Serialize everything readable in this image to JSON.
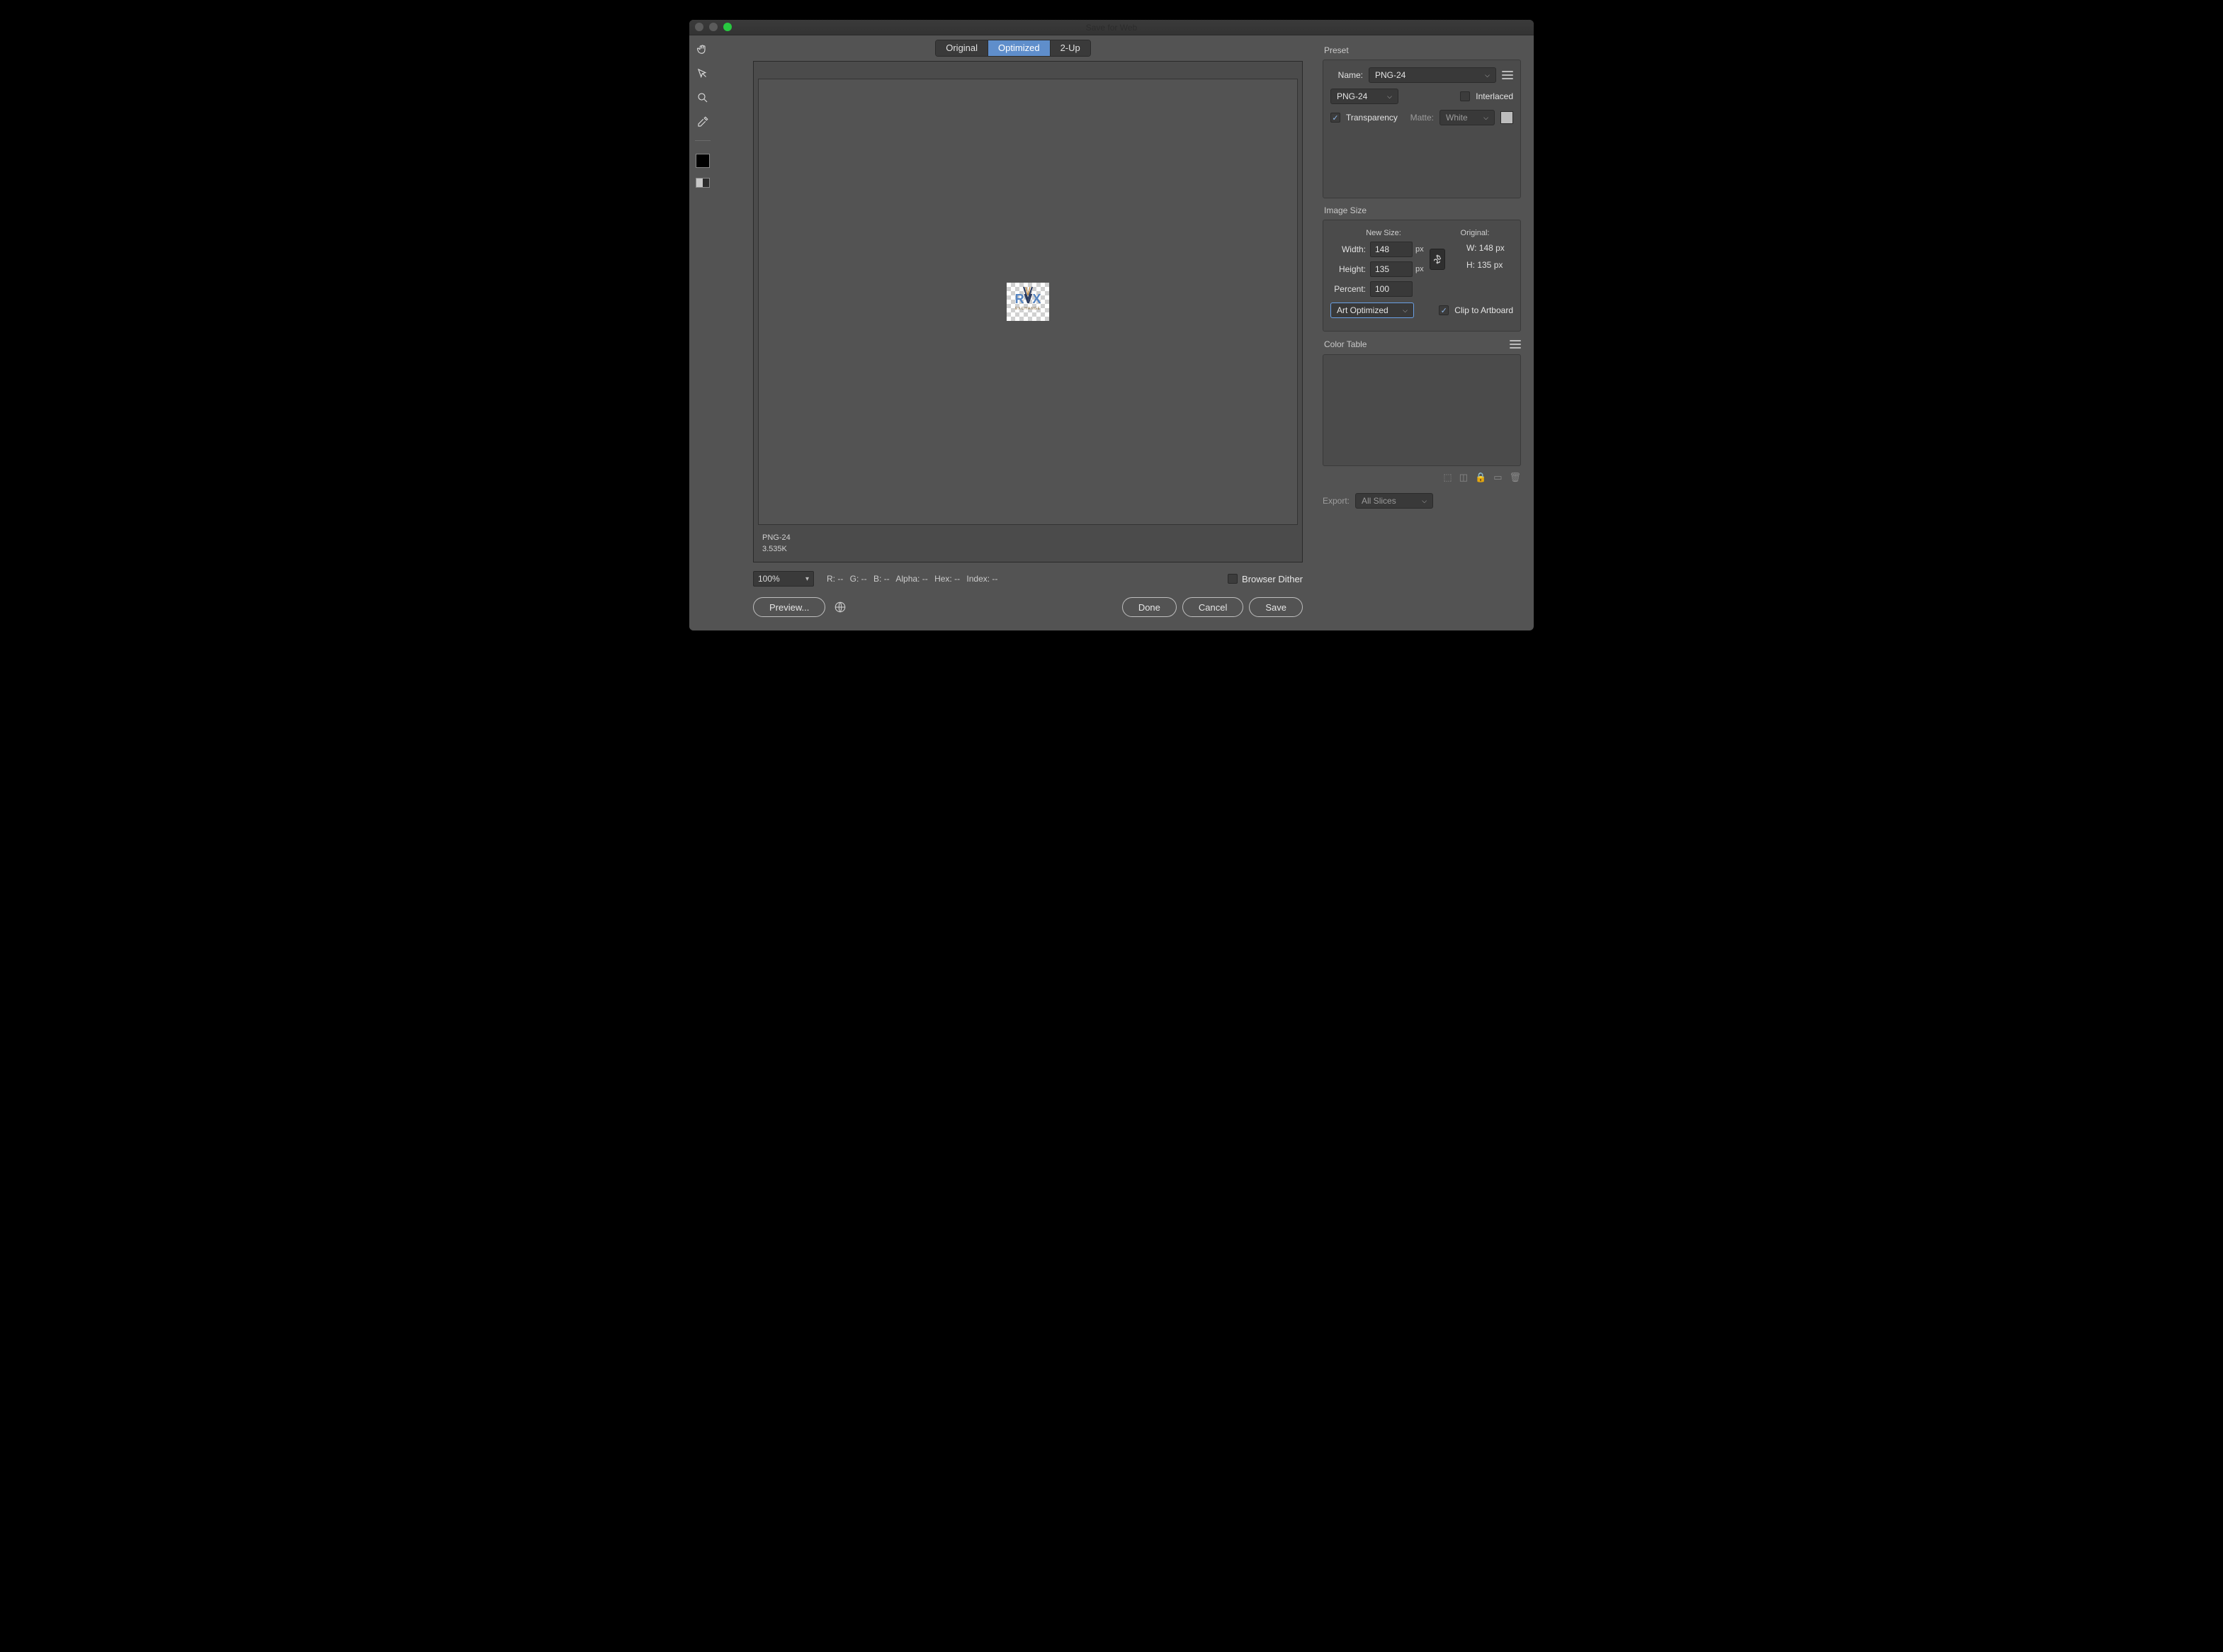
{
  "window": {
    "title": "Save for Web"
  },
  "tabs": {
    "original": "Original",
    "optimized": "Optimized",
    "two_up": "2-Up",
    "active": "optimized"
  },
  "toolbar": {
    "hand": "hand-tool",
    "slice_select": "slice-select-tool",
    "zoom": "zoom-tool",
    "eyedropper": "eyedropper-tool",
    "foreground": "foreground-color",
    "slice_vis": "toggle-slices"
  },
  "preview_meta": {
    "format": "PNG-24",
    "size": "3.535K"
  },
  "preview_logo": {
    "text_r": "R",
    "text_v": "V",
    "text_x": "X",
    "sub": "EXCHANGE"
  },
  "status": {
    "zoom": "100%",
    "r": "R: --",
    "g": "G: --",
    "b": "B: --",
    "alpha": "Alpha: --",
    "hex": "Hex: --",
    "index": "Index: --",
    "browser_dither": "Browser Dither",
    "browser_dither_checked": false
  },
  "buttons": {
    "preview": "Preview...",
    "done": "Done",
    "cancel": "Cancel",
    "save": "Save"
  },
  "preset": {
    "section": "Preset",
    "name_label": "Name:",
    "name_value": "PNG-24",
    "format_value": "PNG-24",
    "interlaced_label": "Interlaced",
    "interlaced_checked": false,
    "transparency_label": "Transparency",
    "transparency_checked": true,
    "matte_label": "Matte:",
    "matte_value": "White"
  },
  "image_size": {
    "section": "Image Size",
    "new_size_label": "New Size:",
    "original_label": "Original:",
    "width_label": "Width:",
    "width_value": "148",
    "width_unit": "px",
    "height_label": "Height:",
    "height_value": "135",
    "height_unit": "px",
    "percent_label": "Percent:",
    "percent_value": "100",
    "orig_w": "W:  148 px",
    "orig_h": "H:  135 px",
    "quality_value": "Art Optimized",
    "clip_label": "Clip to Artboard",
    "clip_checked": true
  },
  "color_table": {
    "section": "Color Table"
  },
  "export": {
    "label": "Export:",
    "value": "All Slices"
  }
}
